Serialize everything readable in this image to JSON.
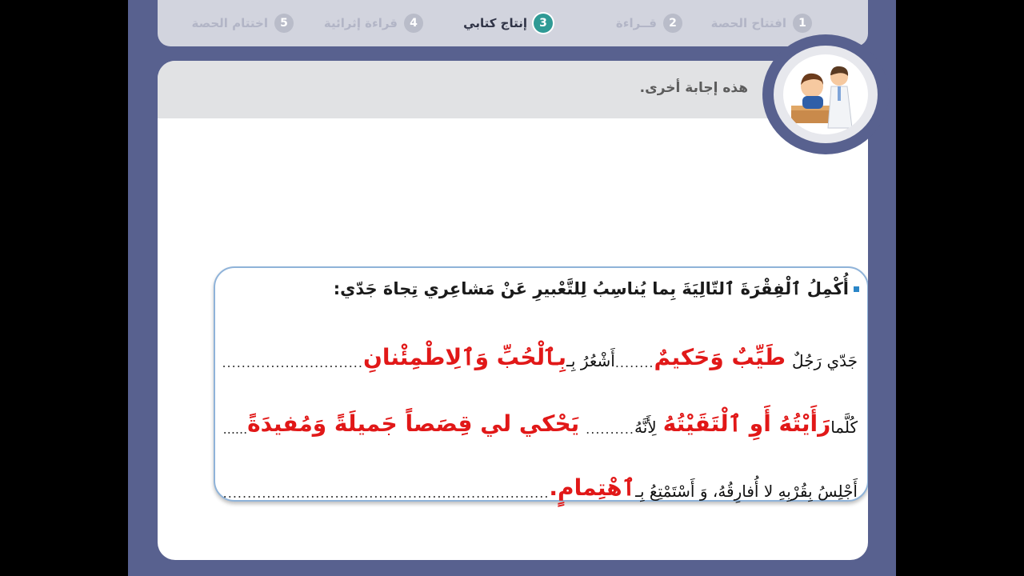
{
  "nav": {
    "steps": [
      {
        "num": "1",
        "label": "افتتاح الحصة"
      },
      {
        "num": "2",
        "label": "قــراءة"
      },
      {
        "num": "3",
        "label": "إنتاج كتابي"
      },
      {
        "num": "4",
        "label": "قراءة إثرائية"
      },
      {
        "num": "5",
        "label": "اختتام الحصة"
      }
    ],
    "active_index": 2
  },
  "answer_bar": {
    "text": "هذه إجابة أخرى."
  },
  "avatar": {
    "icon": "teacher-student-icon"
  },
  "exercise": {
    "prompt": "أُكْمِلُ ٱلْفِقْرَةَ ٱلتّالِيَةَ بِما يُناسِبُ لِلتَّعْبيرِ عَنْ مَشاعِري تِجاهَ جَدّي:",
    "line1": {
      "t1": "جَدّي رَجُلٌ",
      "a1": "طَيِّبٌ وَحَكيمٌ",
      "dots1": "........",
      "t2": "أَشْعُرُ بِـ",
      "a2": "بِٱلْحُبِّ وَٱلِاطْمِئْنانِ",
      "dots2": "......................................"
    },
    "line2": {
      "t1": "كُلَّما",
      "a1": "رَأَيْتُهُ أَوِ ٱلْتَقَيْتُهُ",
      "t2": "لِأَنَّهُ",
      "dots1": "..........",
      "a2": "يَحْكي لي قِصَصاً جَميلَةً وَمُفيدَةً",
      "dots2": "...................................،"
    },
    "line3": {
      "t1": "أَجْلِسُ بِقُرْبِهِ لا أُفارِقُهُ، وَ أَسْتَمْتِعُ بِـ",
      "a1": "ٱهْتِمامٍ.",
      "dots1": "................................................................................................"
    }
  },
  "colors": {
    "accent": "#2f9a95",
    "frame": "#58618f",
    "answer_red": "#e11818",
    "border": "#8fb3d9"
  }
}
